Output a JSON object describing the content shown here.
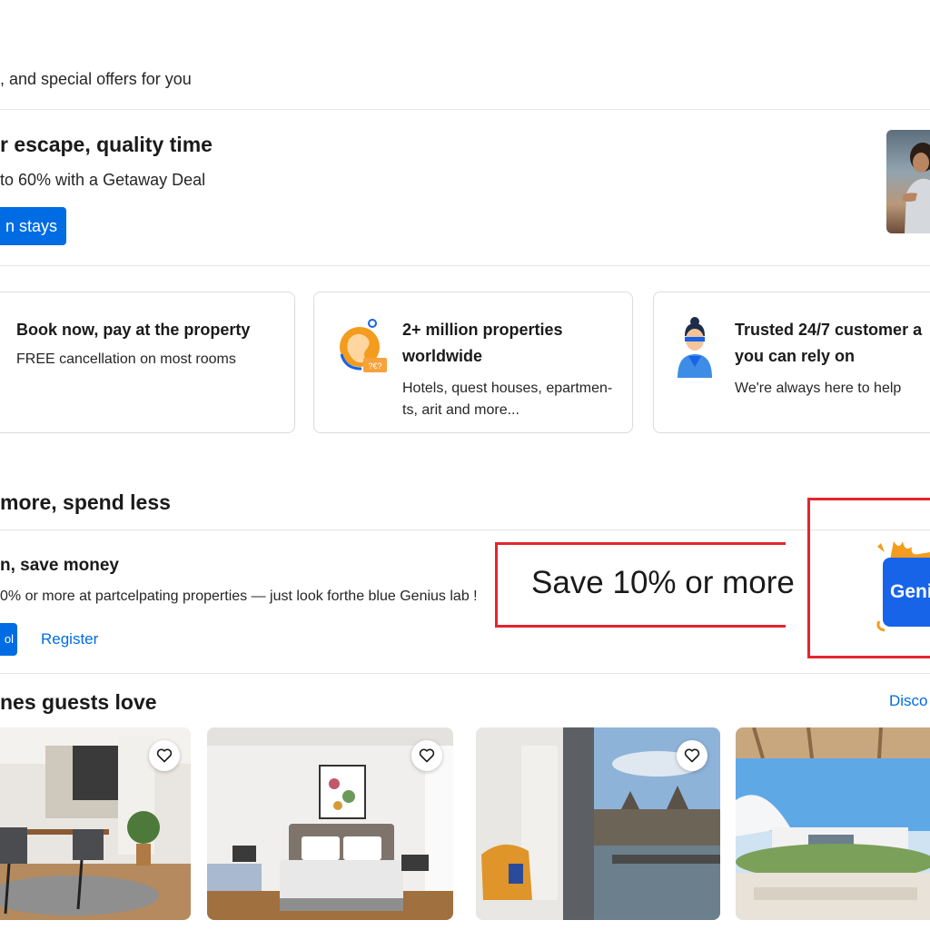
{
  "header": {
    "subtitle": ", and special offers for you"
  },
  "promo": {
    "title": "r escape, quality time",
    "text": " to 60% with a Getaway Deal",
    "button_label": "n stays"
  },
  "features": [
    {
      "title_lines": [
        "Book now, pay at the property"
      ],
      "desc_lines": [
        "FREE cancellation on most rooms"
      ],
      "icon": "calendar-icon"
    },
    {
      "title_lines": [
        "2+ million properties",
        "worldwide"
      ],
      "desc_lines": [
        "Hotels, quest houses, epartmen-",
        "ts, arit and more..."
      ],
      "icon": "globe-icon",
      "badge": "?€?"
    },
    {
      "title_lines": [
        "Trusted 24/7 customer a",
        "you can rely on"
      ],
      "desc_lines": [
        "We're always here to help"
      ],
      "icon": "support-agent-icon"
    }
  ],
  "genius": {
    "section_title": " more, spend less",
    "title": "n, save money",
    "text": "0% or more at partcelpating properties — just look forthe blue Genius lab !",
    "signin_label": "ol",
    "register_label": "Register",
    "callout": "Save 10% or more",
    "badge_label": "Genius"
  },
  "homes": {
    "section_title": "nes guests love",
    "discover_label": "Disco",
    "photos": [
      "kitchen-dining-photo",
      "hotel-bedroom-photo",
      "city-view-lounge-photo",
      "terrace-pool-photo"
    ]
  },
  "colors": {
    "brand_blue": "#006ce4",
    "highlight_red": "#e3262d",
    "genius_blue": "#1764e8"
  }
}
